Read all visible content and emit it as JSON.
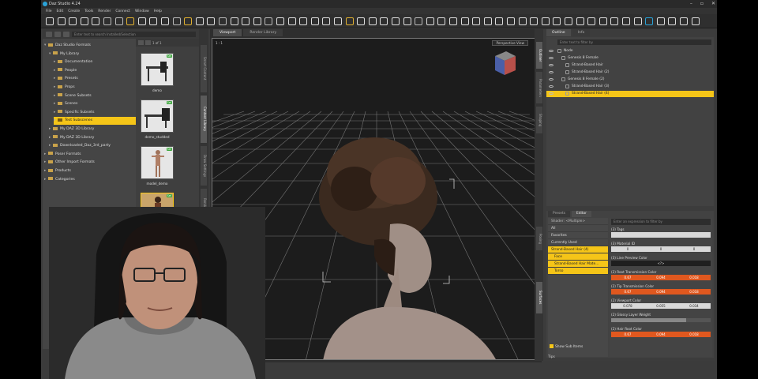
{
  "window": {
    "title": "Daz Studio 4.24"
  },
  "menu": [
    "File",
    "Edit",
    "Create",
    "Tools",
    "Render",
    "Connect",
    "Window",
    "Help"
  ],
  "library": {
    "filter_placeholder": "Enter text to search Installed/Selection",
    "tree": [
      {
        "label": "Daz Studio Formats",
        "expanded": true
      },
      {
        "label": "My Library",
        "expanded": true
      },
      {
        "label": "Documentation"
      },
      {
        "label": "People"
      },
      {
        "label": "Presets"
      },
      {
        "label": "Props"
      },
      {
        "label": "Scene Subsets"
      },
      {
        "label": "Scenes"
      },
      {
        "label": "Specific Subsets"
      },
      {
        "label": "Test Subscenes",
        "selected": true
      },
      {
        "label": "My DAZ 3D Library"
      },
      {
        "label": "My DAZ 3D Library"
      },
      {
        "label": "Downloaded_Daz_3rd_party"
      },
      {
        "label": "Poser Formats"
      },
      {
        "label": "Other Import Formats"
      },
      {
        "label": "Products"
      },
      {
        "label": "Categories"
      }
    ],
    "paging": "1 of 1",
    "thumbs": [
      {
        "label": "demo",
        "badge": "Sel"
      },
      {
        "label": "demo_studded",
        "badge": "Sel"
      },
      {
        "label": "model_demo",
        "badge": "Sel"
      },
      {
        "label": "",
        "badge": "Sel"
      }
    ],
    "side_tabs": [
      "Smart Content",
      "Content Library",
      "Draw Settings",
      "Render Settings"
    ]
  },
  "viewport": {
    "tabs": [
      "Viewport",
      "Render Library"
    ],
    "view": "Perspective View",
    "corner_label": "1 : 1"
  },
  "outline": {
    "tabs": [
      "Outline",
      "Info"
    ],
    "filter_placeholder": "Enter text to filter by",
    "rows": [
      {
        "label": "Node",
        "level": 0
      },
      {
        "label": "Genesis 8 Female",
        "level": 1
      },
      {
        "label": "Strand-Based Hair",
        "level": 2
      },
      {
        "label": "Strand-Based Hair (2)",
        "level": 2
      },
      {
        "label": "Genesis 8 Female (2)",
        "level": 1
      },
      {
        "label": "Strand-Based Hair (3)",
        "level": 2
      },
      {
        "label": "Strand-Based Hair (4)",
        "level": 2,
        "selected": true
      }
    ]
  },
  "surfaces": {
    "tabs": [
      "Presets",
      "Editor"
    ],
    "shader": "Shader: <Multiple>",
    "left_items": [
      {
        "label": "All"
      },
      {
        "label": "Favorites"
      },
      {
        "label": "Currently Used"
      },
      {
        "label": "Strand-Based Hair (4)",
        "selected": true
      },
      {
        "label": "Face",
        "sub": true
      },
      {
        "label": "Strand-Based Hair Mate...",
        "sub": true
      },
      {
        "label": "Torso",
        "sub": true
      }
    ],
    "search_placeholder": "Enter an expression to filter by",
    "properties": [
      {
        "name": "(3) Tags",
        "style": "light",
        "values": [
          ""
        ]
      },
      {
        "name": "(3) Material ID",
        "style": "light",
        "values": [
          "0",
          "0",
          "0"
        ]
      },
      {
        "name": "(3) Line Preview Color",
        "style": "dark",
        "values": [
          "<?>"
        ]
      },
      {
        "name": "(2) Root Transmission Color",
        "style": "orange",
        "values": [
          "0.67",
          "0.094",
          "0.018"
        ]
      },
      {
        "name": "(2) Tip Transmission Color",
        "style": "orange",
        "values": [
          "0.67",
          "0.094",
          "0.018"
        ]
      },
      {
        "name": "(2) Viewport Color",
        "style": "light",
        "values": [
          "0.078",
          "0.055",
          "0.034"
        ]
      },
      {
        "name": "(2) Glossy Layer Weight",
        "style": "slider",
        "values": []
      },
      {
        "name": "(2) Hair Root Color",
        "style": "orange",
        "values": [
          "0.67",
          "0.094",
          "0.018"
        ]
      }
    ],
    "show_sub_items": "Show Sub Items",
    "tips": "Tips"
  },
  "right_side_tabs": [
    "Outliner",
    "Parameters",
    "Shaping",
    "Posing",
    "Surfaces"
  ],
  "colors": {
    "accent": "#f5c518",
    "orange": "#e0581f",
    "panel": "#3c3c3c"
  }
}
